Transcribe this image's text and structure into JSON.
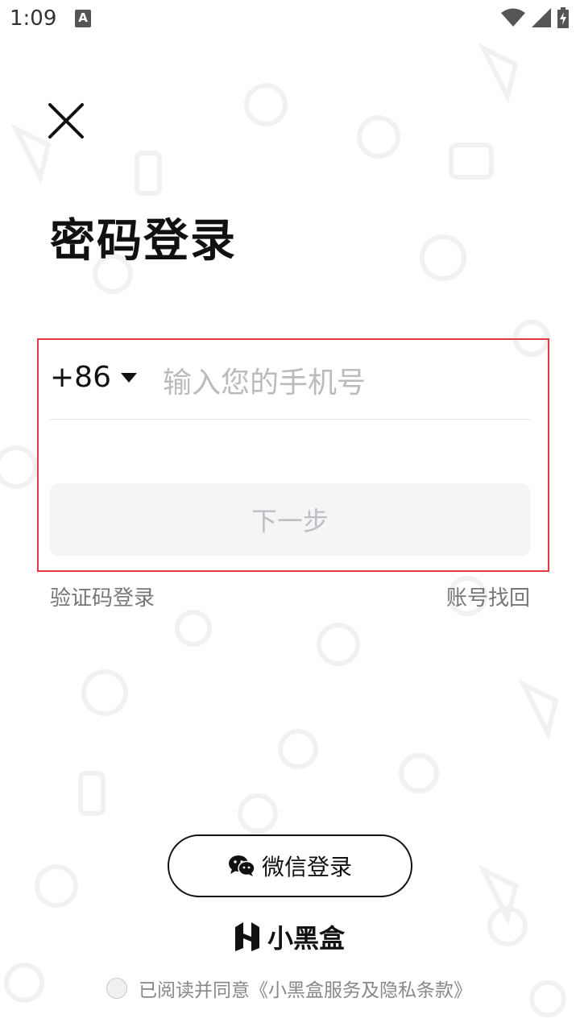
{
  "status_bar": {
    "time": "1:09",
    "notification_icon_letter": "A"
  },
  "header": {
    "title": "密码登录"
  },
  "phone_form": {
    "country_code": "+86",
    "phone_placeholder": "输入您的手机号",
    "phone_value": "",
    "next_button_label": "下一步"
  },
  "links": {
    "sms_login": "验证码登录",
    "account_recovery": "账号找回"
  },
  "wechat_login": {
    "label": "微信登录"
  },
  "brand": {
    "name": "小黑盒"
  },
  "agreement": {
    "text": "已阅读并同意《小黑盒服务及隐私条款》",
    "checked": false
  },
  "colors": {
    "highlight_border": "#e23b46",
    "next_button_bg": "#f4f5f7",
    "next_button_text": "#bdbfc3",
    "placeholder": "#bbbbbb"
  }
}
